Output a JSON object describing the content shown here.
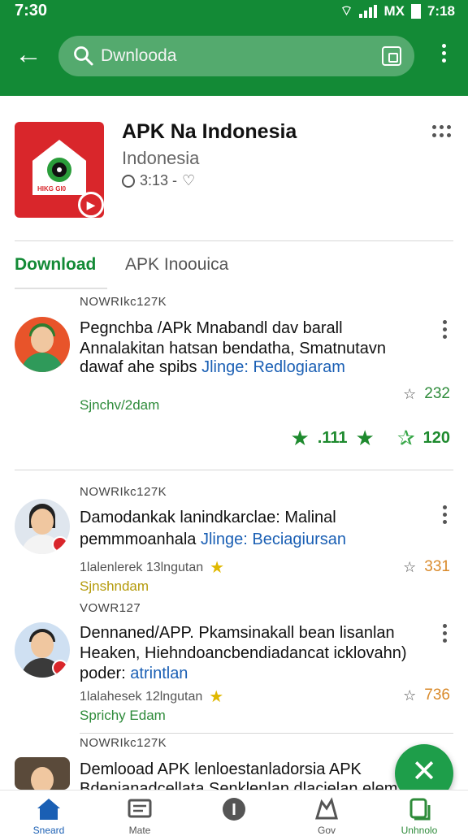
{
  "status": {
    "time_left": "7:30",
    "carrier": "MX",
    "time_right": "7:18"
  },
  "search": {
    "value": "Dwnlooda"
  },
  "app": {
    "title": "APK Na Indonesia",
    "subtitle": "Indonesia",
    "meta": "3:13 -",
    "icon_tag": "HIKG GI0"
  },
  "tabs": {
    "download": "Download",
    "apk": "APK Inoouica"
  },
  "items": [
    {
      "count": "NOWRIkc127K",
      "title": "Pegnchba /APk Mnabandl dav barall",
      "line2": "Annalakitan hatsan bendatha, Smatnutavn",
      "line3_prefix": "dawaf ahe spibs",
      "line3_link": "Jlinge: Redlogiaram",
      "sub": "Sjnchv/2dam",
      "rating": "232",
      "stars_label": ".111",
      "stars_count": "120"
    },
    {
      "count": "NOWRIkc127K",
      "title": "Damodankak lanindkarclae: Malinal",
      "line2_prefix": "pemmmoanhala",
      "line2_link": "Jlinge: Beciagiursan",
      "meta": "1lalenlerek 13lngutan",
      "sub": "Sjnshndam",
      "rating": "331"
    },
    {
      "count": "VOWR127",
      "title": "Dennaned/APP. Pkamsinakall bean lisanlan",
      "line2": "Heaken, Hiehndoancbendiadancat icklovahn)",
      "line3_prefix": "poder:",
      "line3_link": "atrintlan",
      "meta": "1lalahesek 12lngutan",
      "sub": "Sprichy Edam",
      "rating": "736"
    },
    {
      "count": "NOWRIkc127K",
      "title": "Demlooad APK lenloestanladorsia APK",
      "line2": "Bdenianadcellata Senklenlan dlacielan elem"
    }
  ],
  "nav": [
    "Sneard",
    "Mate",
    "",
    "Gov",
    "Unhnolo"
  ],
  "colors": {
    "brand": "#138a36",
    "link": "#1a5fb4",
    "fab": "#1e9e4a"
  }
}
